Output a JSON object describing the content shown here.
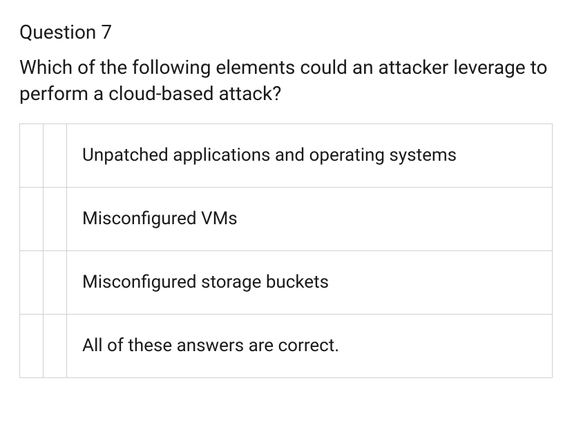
{
  "question": {
    "number": "Question 7",
    "text": "Which of the following elements could an attacker leverage to perform a cloud-based attack?",
    "options": [
      "Unpatched applications and operating systems",
      "Misconfigured VMs",
      "Misconfigured storage buckets",
      "All of these answers are correct."
    ]
  }
}
